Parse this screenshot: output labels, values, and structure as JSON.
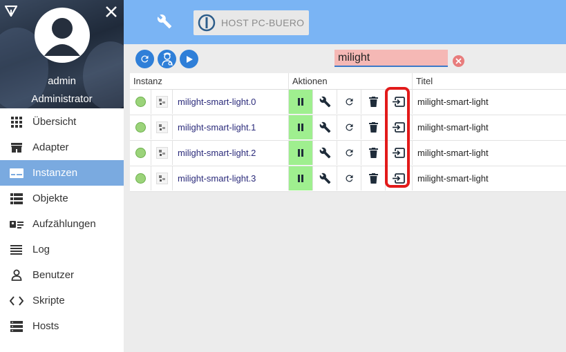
{
  "user": {
    "name": "admin",
    "role": "Administrator"
  },
  "menu": [
    {
      "label": "Übersicht",
      "icon": "grid-icon",
      "active": false
    },
    {
      "label": "Adapter",
      "icon": "store-icon",
      "active": false
    },
    {
      "label": "Instanzen",
      "icon": "instances-icon",
      "active": true
    },
    {
      "label": "Objekte",
      "icon": "list-icon",
      "active": false
    },
    {
      "label": "Aufzählungen",
      "icon": "enum-icon",
      "active": false
    },
    {
      "label": "Log",
      "icon": "log-icon",
      "active": false
    },
    {
      "label": "Benutzer",
      "icon": "user-icon",
      "active": false
    },
    {
      "label": "Skripte",
      "icon": "code-icon",
      "active": false
    },
    {
      "label": "Hosts",
      "icon": "hosts-icon",
      "active": false
    }
  ],
  "header": {
    "host_label": "HOST PC-BUERO"
  },
  "filter": {
    "value": "milight"
  },
  "table": {
    "columns": {
      "instance": "Instanz",
      "actions": "Aktionen",
      "title": "Titel"
    },
    "rows": [
      {
        "name": "milight-smart-light.0",
        "title": "milight-smart-light"
      },
      {
        "name": "milight-smart-light.1",
        "title": "milight-smart-light"
      },
      {
        "name": "milight-smart-light.2",
        "title": "milight-smart-light"
      },
      {
        "name": "milight-smart-light.3",
        "title": "milight-smart-light"
      }
    ]
  },
  "colors": {
    "topbar": "#7ab4f4",
    "active_menu": "#7aaae0",
    "running": "#9fef8f",
    "highlight": "#e21a1a",
    "filter_bg": "#f5b8b5"
  }
}
